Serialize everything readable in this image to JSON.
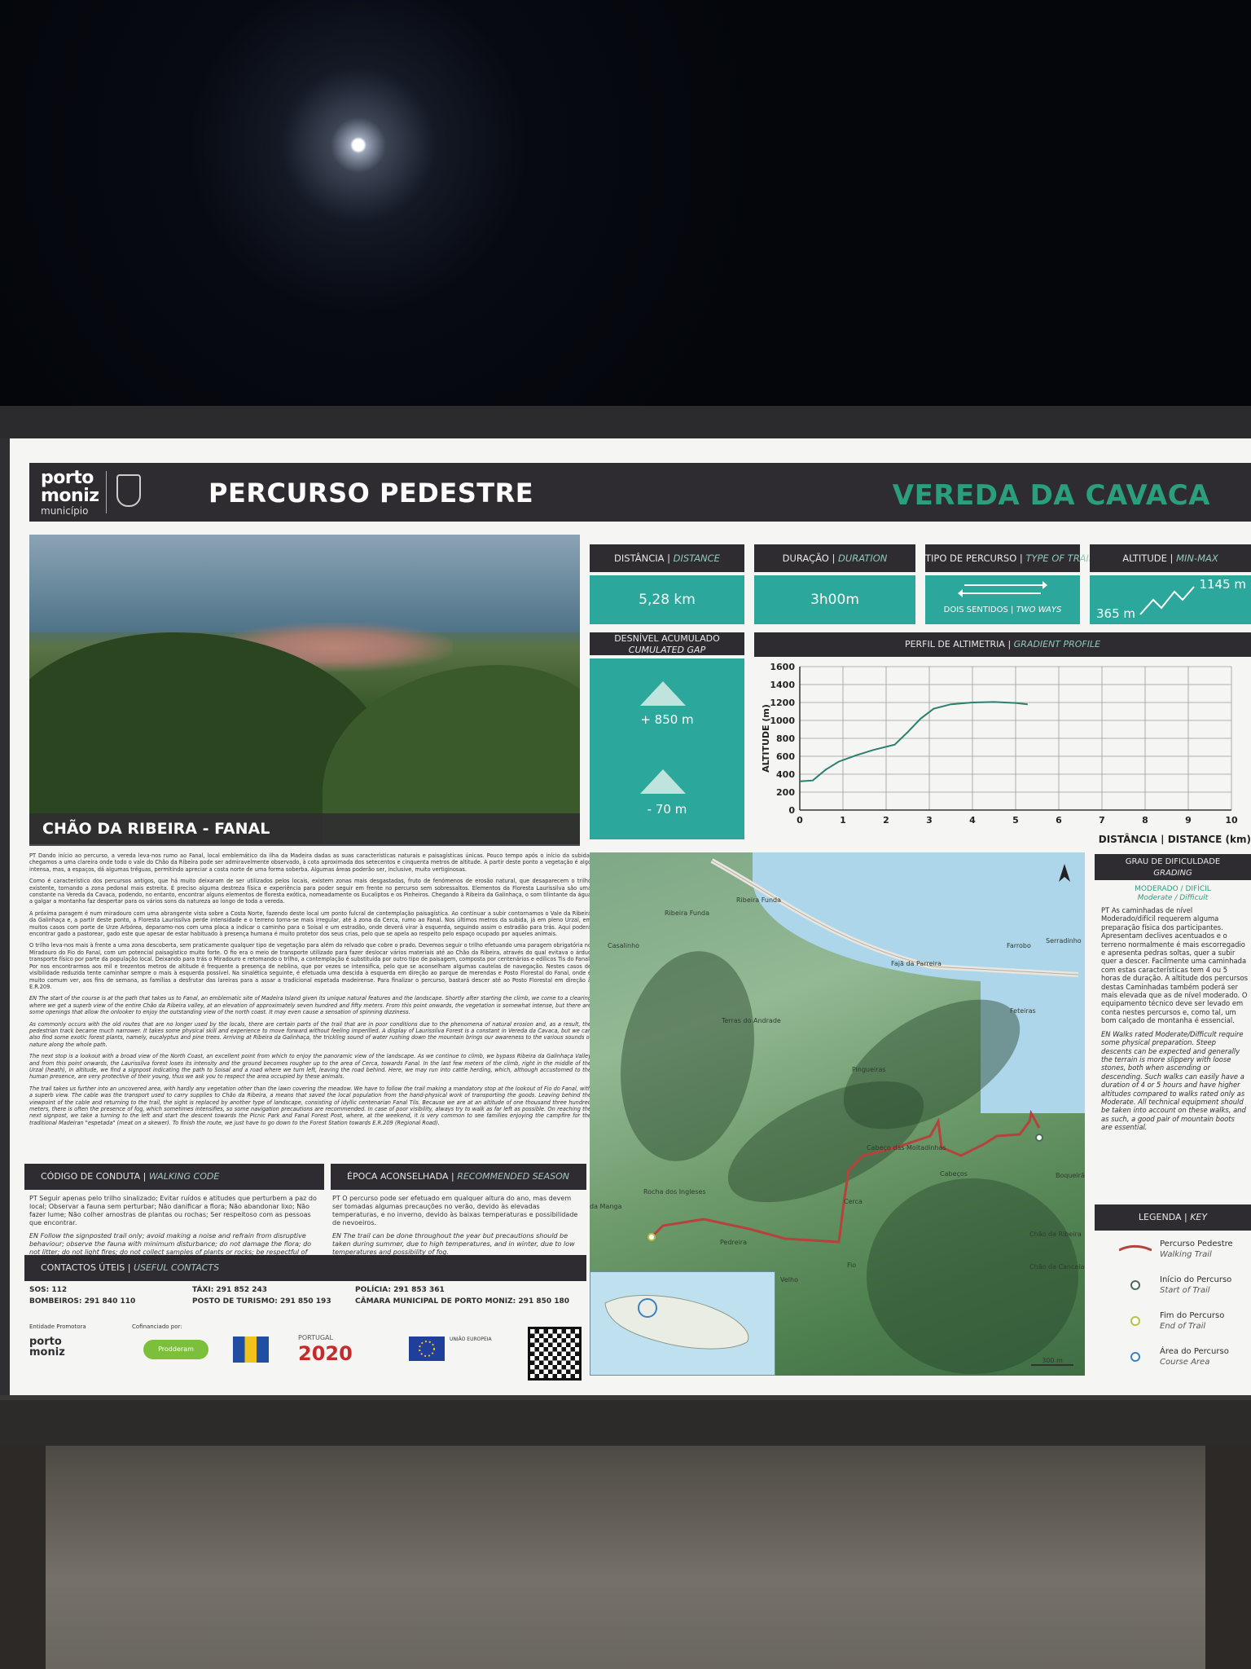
{
  "header": {
    "logo_line1": "porto",
    "logo_line2": "moniz",
    "logo_line3": "município",
    "title": "PERCURSO PEDESTRE",
    "trail_name": "VEREDA DA CAVACA"
  },
  "photo": {
    "caption": "CHÃO DA RIBEIRA - FANAL"
  },
  "stats": {
    "distance": {
      "label_pt": "DISTÂNCIA",
      "label_en": "DISTANCE",
      "value": "5,28 km"
    },
    "duration": {
      "label_pt": "DURAÇÃO",
      "label_en": "DURATION",
      "value": "3h00m"
    },
    "trail_type": {
      "label_pt": "TIPO DE PERCURSO",
      "label_en": "TYPE OF TRAIL",
      "value_pt": "DOIS SENTIDOS",
      "value_en": "TWO WAYS"
    },
    "altitude": {
      "label_pt": "ALTITUDE",
      "label_en": "MIN-MAX",
      "min": "365 m",
      "max": "1145 m"
    },
    "gap": {
      "label_pt": "DESNÍVEL ACUMULADO",
      "label_en": "CUMULATED GAP",
      "up": "+ 850 m",
      "down": "- 70 m"
    }
  },
  "profile": {
    "label_pt": "PERFIL DE ALTIMETRIA",
    "label_en": "GRADIENT PROFILE",
    "y_axis": "ALTITUDE (m)",
    "x_axis_pt": "DISTÂNCIA",
    "x_axis_en": "DISTANCE (km)"
  },
  "chart_data": {
    "type": "line",
    "title": "PERFIL DE ALTIMETRIA | GRADIENT PROFILE",
    "xlabel": "DISTÂNCIA | DISTANCE (km)",
    "ylabel": "ALTITUDE (m)",
    "xlim": [
      0,
      10
    ],
    "ylim": [
      0,
      1600
    ],
    "xticks": [
      0,
      1,
      2,
      3,
      4,
      5,
      6,
      7,
      8,
      9,
      10
    ],
    "yticks": [
      0,
      200,
      400,
      600,
      800,
      1000,
      1200,
      1400,
      1600
    ],
    "grid": true,
    "series": [
      {
        "values": [
          [
            0,
            320
          ],
          [
            0.3,
            330
          ],
          [
            0.6,
            450
          ],
          [
            0.9,
            540
          ],
          [
            1.3,
            610
          ],
          [
            1.7,
            670
          ],
          [
            2.2,
            730
          ],
          [
            2.5,
            870
          ],
          [
            2.8,
            1020
          ],
          [
            3.1,
            1130
          ],
          [
            3.5,
            1180
          ],
          [
            4.0,
            1200
          ],
          [
            4.5,
            1205
          ],
          [
            5.0,
            1195
          ],
          [
            5.28,
            1180
          ]
        ]
      }
    ],
    "color": "#2a7f6e"
  },
  "description": {
    "pt_1": "PT Dando início ao percurso, a vereda leva-nos rumo ao Fanal, local emblemático da ilha da Madeira dadas as suas características naturais e paisagísticas únicas. Pouco tempo após o início da subida, chegamos a uma clareira onde todo o vale do Chão da Ribeira pode ser admiravelmente observado, à cota aproximada dos setecentos e cinquenta metros de altitude. A partir deste ponto a vegetação é algo intensa, mas, a espaços, dá algumas tréguas, permitindo apreciar a costa norte de uma forma soberba. Algumas áreas poderão ser, inclusive, muito vertiginosas.",
    "pt_2": "Como é característico dos percursos antigos, que há muito deixaram de ser utilizados pelos locais, existem zonas mais desgastadas, fruto de fenómenos de erosão natural, que desaparecem o trilho existente, tornando a zona pedonal mais estreita. É preciso alguma destreza física e experiência para poder seguir em frente no percurso sem sobressaltos. Elementos da Floresta Laurissilva são uma constante na Vereda da Cavaca, podendo, no entanto, encontrar alguns elementos de floresta exótica, nomeadamente os Eucaliptos e os Pinheiros. Chegando à Ribeira da Galinhaça, o som tilintante da água a galgar a montanha faz despertar para os vários sons da natureza ao longo de toda a vereda.",
    "pt_3": "A próxima paragem é num miradouro com uma abrangente vista sobre a Costa Norte, fazendo deste local um ponto fulcral de contemplação paisagística. Ao continuar a subir contornamos o Vale da Ribeira da Galinhaça e, a partir deste ponto, a Floresta Laurissilva perde intensidade e o terreno torna-se mais irregular, até à zona da Cerca, rumo ao Fanal. Nos últimos metros da subida, já em pleno Urzal, em muitos casos com porte de Urze Arbórea, deparamo-nos com uma placa a indicar o caminho para o Soisal e um estradão, onde deverá virar à esquerda, seguindo assim o estradão para trás. Aqui poderá encontrar gado a pastorear, gado este que apesar de estar habituado à presença humana é muito protetor dos seus crias, pelo que se apela ao respeito pelo espaço ocupado por aqueles animais.",
    "pt_4": "O trilho leva-nos mais à frente a uma zona descoberta, sem praticamente qualquer tipo de vegetação para além do relvado que cobre o prado. Devemos seguir o trilho efetuando uma paragem obrigatória no Miradouro do Fio do Fanal, com um potencial paisagístico muito forte. O fio era o meio de transporte utilizado para fazer deslocar vários materiais até ao Chão da Ribeira, através do qual evitava o árduo transporte físico por parte da população local. Deixando para trás o Miradouro e retomando o trilho, a contemplação é substituída por outro tipo de paisagem, composta por centenários e edílicos Tis do Fanal. Por nos encontrarmos aos mil e trezentos metros de altitude é frequente a presença de neblina, que por vezes se intensifica, pelo que se aconselham algumas cautelas de navegação. Nestes casos de visibilidade reduzida tente caminhar sempre o mais à esquerda possível. Na sinalética seguinte, é efetuada uma descida à esquerda em direção ao parque de merendas e Posto Florestal do Fanal, onde é muito comum ver, aos fins de semana, as famílias a desfrutar das lareiras para a assar a tradicional espetada madeirense. Para finalizar o percurso, bastará descer até ao Posto Florestal em direção à E.R.209.",
    "en_1": "EN The start of the course is at the path that takes us to Fanal, an emblematic site of Madeira Island given its unique natural features and the landscape. Shortly after starting the climb, we come to a clearing where we get a superb view of the entire Chão da Ribeira valley, at an elevation of approximately seven hundred and fifty meters. From this point onwards, the vegetation is somewhat intense, but there are some openings that allow the onlooker to enjoy the outstanding view of the north coast. It may even cause a sensation of spinning dizziness.",
    "en_2": "As commonly occurs with the old routes that are no longer used by the locals, there are certain parts of the trail that are in poor conditions due to the phenomena of natural erosion and, as a result, the pedestrian track became much narrower. It takes some physical skill and experience to move forward without feeling imperilled. A display of Laurissilva Forest is a constant in Vereda da Cavaca, but we can also find some exotic forest plants, namely, eucalyptus and pine trees. Arriving at Ribeira da Galinhaça, the trickling sound of water rushing down the mountain brings our awareness to the various sounds of nature along the whole path.",
    "en_3": "The next stop is a lookout with a broad view of the North Coast, an excellent point from which to enjoy the panoramic view of the landscape. As we continue to climb, we bypass Ribeira da Galinhaça Valley and from this point onwards, the Laurissilva forest loses its intensity and the ground becomes rougher up to the area of Cerca, towards Fanal. In the last few meters of the climb, right in the middle of the Urzal (heath), in altitude, we find a signpost indicating the path to Soisal and a road where we turn left, leaving the road behind. Here, we may run into cattle herding, which, although accustomed to the human presence, are very protective of their young, thus we ask you to respect the area occupied by these animals.",
    "en_4": "The trail takes us further into an uncovered area, with hardly any vegetation other than the lawn covering the meadow. We have to follow the trail making a mandatory stop at the lookout of Fio do Fanal, with a superb view. The cable was the transport used to carry supplies to Chão da Ribeira, a means that saved the local population from the hand-physical work of transporting the goods. Leaving behind the viewpoint of the cable and returning to the trail, the sight is replaced by another type of landscape, consisting of idyllic centenarian Fanal Tils. Because we are at an altitude of one thousand three hundred meters, there is often the presence of fog, which sometimes intensifies, so some navigation precautions are recommended. In case of poor visibility, always try to walk as far left as possible. On reaching the next signpost, we take a turning to the left and start the descent towards the Picnic Park and Fanal Forest Post, where, at the weekend, it is very common to see families enjoying the campfire for the traditional Madeiran \"espetada\" (meat on a skewer). To finish the route, we just have to go down to the Forest Station towards E.R.209 (Regional Road)."
  },
  "conduct": {
    "label_pt": "CÓDIGO DE CONDUTA",
    "label_en": "WALKING CODE",
    "pt": "PT Seguir apenas pelo trilho sinalizado; Evitar ruídos e atitudes que perturbem a paz do local; Observar a fauna sem perturbar; Não danificar a flora; Não abandonar lixo; Não fazer lume; Não colher amostras de plantas ou rochas; Ser respeitoso com as pessoas que encontrar.",
    "en": "EN Follow the signposted trail only; avoid making a noise and refrain from disruptive behaviour; observe the fauna with minimum disturbance; do not damage the flora; do not litter; do not light fires; do not collect samples of plants or rocks; be respectful of people you encounter."
  },
  "season": {
    "label_pt": "ÉPOCA ACONSELHADA",
    "label_en": "RECOMMENDED SEASON",
    "pt": "PT O percurso pode ser efetuado em qualquer altura do ano, mas devem ser tomadas algumas precauções no verão, devido às elevadas temperaturas, e no inverno, devido às baixas temperaturas e possibilidade de nevoeiros.",
    "en": "EN The trail can be done throughout the year but precautions should be taken during summer, due to high temperatures, and in winter, due to low temperatures and possibility of fog."
  },
  "contacts": {
    "label_pt": "CONTACTOS ÚTEIS",
    "label_en": "USEFUL CONTACTS",
    "sos": "SOS: 112",
    "bombeiros": "BOMBEIROS: 291 840 110",
    "taxi": "TÁXI: 291 852 243",
    "turismo": "POSTO DE TURISMO: 291 850 193",
    "policia": "POLÍCIA: 291 853 361",
    "camara": "CÂMARA MUNICIPAL DE PORTO MONIZ: 291 850 180"
  },
  "sponsors": {
    "promotora": "Entidade Promotora",
    "cofinanciado": "Cofinanciado por:",
    "prodderam": "Prodderam",
    "portugal": "PORTUGAL",
    "p2020": "2020",
    "ue": "UNIÃO EUROPEIA"
  },
  "map": {
    "ribeira_funda": "Ribeira Funda",
    "ribeira_funda2": "Ribeira Funda",
    "casalinho": "Casalinho",
    "faja_parreira": "Fajã da Parreira",
    "farrobo": "Farrobo",
    "serradinho": "Serradinho",
    "terras_andrade": "Terras do Andrade",
    "feteiras": "Feteiras",
    "pingueiras": "Pingueiras",
    "cabeco_moitadinhas": "Cabeço das Moitadinhas",
    "cabecos": "Cabeços",
    "rocha_ingleses": "Rocha dos Ingleses",
    "cerca": "Cerca",
    "da_manga": "da Manga",
    "pedreira": "Pedreira",
    "chao_ribeira": "Chão da Ribeira",
    "chao_cancela": "Chão da Cancela",
    "boqueirao": "Boqueirão",
    "fio": "Fio",
    "velho": "Velho",
    "scale": "300 m"
  },
  "grading": {
    "label_pt": "GRAU DE DIFICULDADE",
    "label_en": "GRADING",
    "level": "MODERADO / DIFÍCIL",
    "level_en": "Moderate / Difficult",
    "pt": "PT As caminhadas de nível Moderado/difícil requerem alguma preparação física dos participantes. Apresentam declives acentuados e o terreno normalmente é mais escorregadio e apresenta pedras soltas, quer a subir quer a descer. Facilmente uma caminhada com estas características tem 4 ou 5 horas de duração. A altitude dos percursos destas Caminhadas também poderá ser mais elevada que as de nível moderado. O equipamento técnico deve ser levado em conta nestes percursos e, como tal, um bom calçado de montanha é essencial.",
    "en": "EN Walks rated Moderate/Difficult require some physical preparation. Steep descents can be expected and generally the terrain is more slippery with loose stones, both when ascending or descending. Such walks can easily have a duration of 4 or 5 hours and have higher altitudes compared to walks rated only as Moderate. All technical equipment should be taken into account on these walks, and as such, a good pair of mountain boots are essential."
  },
  "legend": {
    "label_pt": "LEGENDA",
    "label_en": "KEY",
    "items": [
      {
        "pt": "Percurso Pedestre",
        "en": "Walking Trail",
        "color": "#b5423b"
      },
      {
        "pt": "Início do Percurso",
        "en": "Start of Trail",
        "color": "#4a6b55"
      },
      {
        "pt": "Fim do Percurso",
        "en": "End of Trail",
        "color": "#b7c24a"
      },
      {
        "pt": "Área do Percurso",
        "en": "Course Area",
        "color": "#3b7fc4"
      }
    ]
  }
}
